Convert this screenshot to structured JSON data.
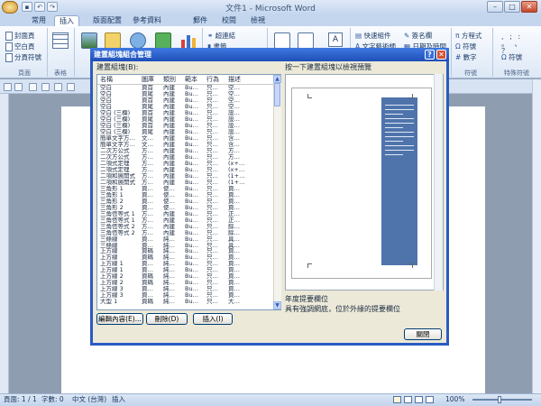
{
  "window": {
    "title": "文件1 - Microsoft Word",
    "controls": [
      "–",
      "□",
      "✕"
    ]
  },
  "ribbon_tabs": [
    "常用",
    "插入",
    "版面配置",
    "參考資料",
    "郵件",
    "校閱",
    "檢視"
  ],
  "active_tab": "插入",
  "ribbon": {
    "pages_group": {
      "items": [
        "封面頁",
        "空白頁",
        "分頁符號"
      ],
      "label": "頁面"
    },
    "table_group": {
      "label": "表格"
    },
    "links_group": {
      "items": [
        "超連結",
        "書籤"
      ]
    },
    "text_group": {
      "items": [
        "快速組件",
        "文字藝術師"
      ]
    },
    "signature_group": {
      "items": [
        "簽名欄",
        "日期及時間"
      ]
    },
    "symbols_group": {
      "items": [
        "方程式",
        "符號",
        "數字"
      ],
      "label": "符號"
    },
    "special_group": {
      "items": [
        "符號"
      ],
      "label": "特殊符號"
    }
  },
  "dialog": {
    "title": "建置組塊組合管理",
    "list_label": "建置組塊(B):",
    "preview_label": "按一下建置組塊以檢視預覽",
    "columns": [
      "名稱",
      "圖庫",
      "類別",
      "範本",
      "行為",
      "描述"
    ],
    "rows": [
      [
        "空白",
        "頁首",
        "內建",
        "Bu…",
        "只…",
        "空…"
      ],
      [
        "空白",
        "頁尾",
        "內建",
        "Bu…",
        "只…",
        "空…"
      ],
      [
        "空白",
        "頁首",
        "內建",
        "Bu…",
        "只…",
        "空…"
      ],
      [
        "空白",
        "頁尾",
        "內建",
        "Bu…",
        "只…",
        "空…"
      ],
      [
        "空白 (三欄)",
        "頁首",
        "內建",
        "Bu…",
        "只…",
        "設…"
      ],
      [
        "空白 (三欄)",
        "頁尾",
        "內建",
        "Bu…",
        "只…",
        "設…"
      ],
      [
        "空白 (三欄)",
        "頁首",
        "內建",
        "Bu…",
        "只…",
        "設…"
      ],
      [
        "空白 (三欄)",
        "頁尾",
        "內建",
        "Bu…",
        "只…",
        "設…"
      ],
      [
        "簡單文字方…",
        "文…",
        "內建",
        "Bu…",
        "只…",
        "含…"
      ],
      [
        "簡單文字方…",
        "文…",
        "內建",
        "Bu…",
        "只…",
        "含…"
      ],
      [
        "二次方公式",
        "方…",
        "內建",
        "Bu…",
        "只…",
        "方…"
      ],
      [
        "二次方公式",
        "方…",
        "內建",
        "Bu…",
        "只…",
        "方…"
      ],
      [
        "二項式定理",
        "方…",
        "內建",
        "Bu…",
        "只…",
        "(x+…"
      ],
      [
        "二項式定理",
        "方…",
        "內建",
        "Bu…",
        "只…",
        "(x+…"
      ],
      [
        "二項和展開式",
        "方…",
        "內建",
        "Bu…",
        "只…",
        "(1+…"
      ],
      [
        "二項和展開式",
        "方…",
        "內建",
        "Bu…",
        "只…",
        "(1+…"
      ],
      [
        "三角形 1",
        "頁…",
        "使…",
        "Bu…",
        "只…",
        "頁…"
      ],
      [
        "三角形 1",
        "頁…",
        "使…",
        "Bu…",
        "只…",
        "頁…"
      ],
      [
        "三角形 2",
        "頁…",
        "使…",
        "Bu…",
        "只…",
        "頁…"
      ],
      [
        "三角形 2",
        "頁…",
        "使…",
        "Bu…",
        "只…",
        "頁…"
      ],
      [
        "三角恆等式 1",
        "方…",
        "內建",
        "Bu…",
        "只…",
        "正…"
      ],
      [
        "三角恆等式 1",
        "方…",
        "內建",
        "Bu…",
        "只…",
        "正…"
      ],
      [
        "三角恆等式 2",
        "方…",
        "內建",
        "Bu…",
        "只…",
        "餘…"
      ],
      [
        "三角恆等式 2",
        "方…",
        "內建",
        "Bu…",
        "只…",
        "餘…"
      ],
      [
        "三條線",
        "頁…",
        "純…",
        "Bu…",
        "只…",
        "具…"
      ],
      [
        "三條線",
        "頁…",
        "純…",
        "Bu…",
        "只…",
        "具…"
      ],
      [
        "上方線",
        "頁碼",
        "純…",
        "Bu…",
        "只…",
        "頁…"
      ],
      [
        "上方線",
        "頁碼",
        "純…",
        "Bu…",
        "只…",
        "頁…"
      ],
      [
        "上方線 1",
        "頁…",
        "純…",
        "Bu…",
        "只…",
        "頁…"
      ],
      [
        "上方線 1",
        "頁…",
        "純…",
        "Bu…",
        "只…",
        "頁…"
      ],
      [
        "上方線 2",
        "頁碼",
        "純…",
        "Bu…",
        "只…",
        "頁…"
      ],
      [
        "上方線 2",
        "頁碼",
        "純…",
        "Bu…",
        "只…",
        "頁…"
      ],
      [
        "上方線 3",
        "頁…",
        "純…",
        "Bu…",
        "只…",
        "頁…"
      ],
      [
        "上方線 3",
        "頁…",
        "純…",
        "Bu…",
        "只…",
        "頁…"
      ],
      [
        "大型 1",
        "頁碼",
        "純…",
        "Bu…",
        "只…",
        "大…"
      ]
    ],
    "buttons": {
      "edit": "編輯內容(E)...",
      "delete": "刪除(D)",
      "insert": "插入(I)",
      "close": "關閉"
    },
    "description_title": "年度提要欄位",
    "description_text": "具有強調網底，位於外緣的提要欄位",
    "help_glyph": "?",
    "close_glyph": "✕"
  },
  "statusbar": {
    "page": "頁面: 1 / 1",
    "words": "字數: 0",
    "language": "中文 (台灣)",
    "mode": "插入",
    "zoom": "100%"
  },
  "icons": [
    "office-button-icon",
    "save-icon",
    "undo-icon",
    "redo-icon",
    "cover-page-icon",
    "table-icon",
    "picture-icon",
    "chart-icon",
    "hyperlink-icon",
    "equation-icon",
    "symbol-icon",
    "zoom-slider-icon"
  ],
  "colors": {
    "dialog_title": "#2a5bc4",
    "preview_block": "#4f74ab",
    "ribbon_bg": "#dde8f6",
    "doc_bg": "#8f9db0"
  }
}
